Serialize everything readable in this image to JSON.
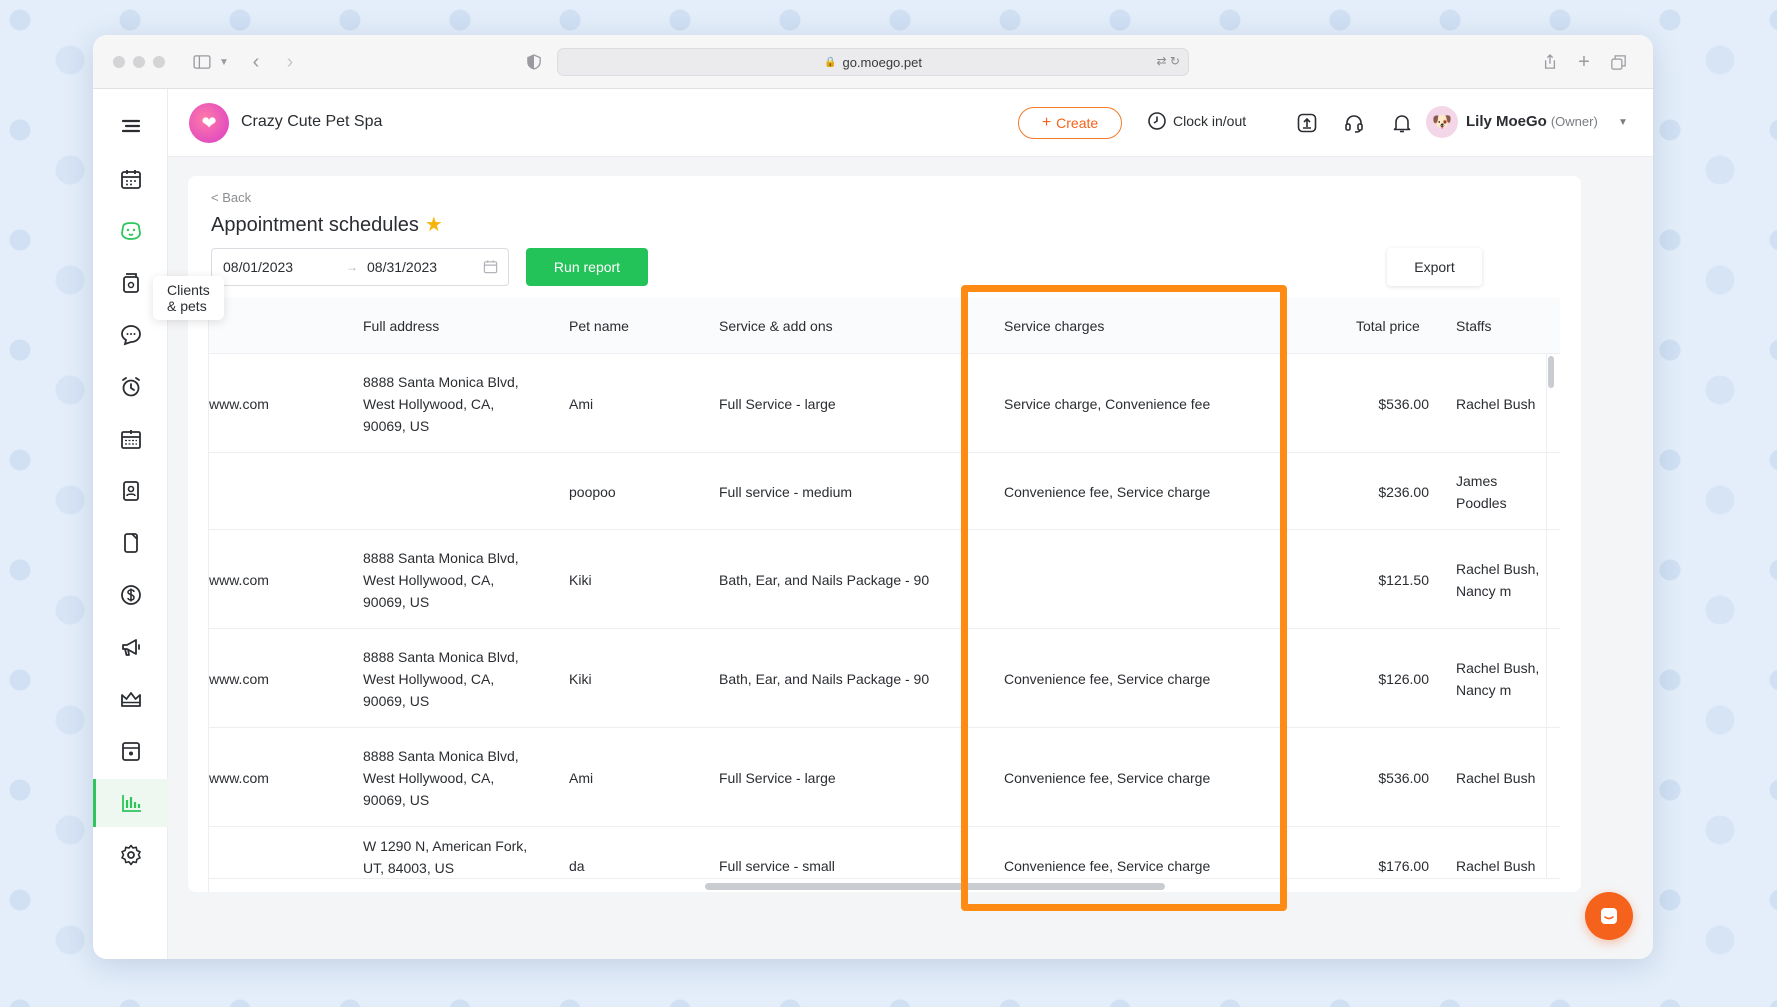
{
  "browser": {
    "url": "go.moego.pet"
  },
  "sidebar": {
    "tooltip": "Clients & pets",
    "items": [
      {
        "icon": "menu-icon"
      },
      {
        "icon": "calendar-icon"
      },
      {
        "icon": "clients-pets-icon"
      },
      {
        "icon": "pet-food-icon"
      },
      {
        "icon": "chat-bubble-icon"
      },
      {
        "icon": "alarm-clock-icon"
      },
      {
        "icon": "schedule-grid-icon"
      },
      {
        "icon": "id-badge-icon"
      },
      {
        "icon": "mobile-device-icon"
      },
      {
        "icon": "dollar-icon"
      },
      {
        "icon": "megaphone-icon"
      },
      {
        "icon": "crown-icon"
      },
      {
        "icon": "booking-icon"
      },
      {
        "icon": "reports-chart-icon"
      },
      {
        "icon": "settings-gear-icon"
      }
    ]
  },
  "header": {
    "business_name": "Crazy Cute Pet Spa",
    "create_label": "Create",
    "clock_label": "Clock in/out",
    "user_name": "Lily MoeGo",
    "user_role": "(Owner)"
  },
  "page": {
    "back_label": "< Back",
    "title": "Appointment schedules",
    "date_start": "08/01/2023",
    "date_end": "08/31/2023",
    "run_label": "Run report",
    "export_label": "Export"
  },
  "table": {
    "columns": [
      "Full address",
      "Pet name",
      "Service & add ons",
      "Service charges",
      "Total price",
      "Staffs"
    ],
    "rows": [
      {
        "email_tail": "www.com",
        "address": [
          "8888 Santa Monica Blvd,",
          "West Hollywood, CA,",
          "90069, US"
        ],
        "pet": "Ami",
        "service": "Full Service - large",
        "charges": "Service charge, Convenience fee",
        "total": "$536.00",
        "staffs": [
          "Rachel Bush"
        ]
      },
      {
        "email_tail": "",
        "address": [],
        "pet": "poopoo",
        "service": "Full service - medium",
        "charges": "Convenience fee, Service charge",
        "total": "$236.00",
        "staffs": [
          "James",
          "Poodles"
        ]
      },
      {
        "email_tail": "www.com",
        "address": [
          "8888 Santa Monica Blvd,",
          "West Hollywood, CA,",
          "90069, US"
        ],
        "pet": "Kiki",
        "service": "Bath, Ear, and Nails Package - 90",
        "charges": "",
        "total": "$121.50",
        "staffs": [
          "Rachel Bush,",
          "Nancy m"
        ]
      },
      {
        "email_tail": "www.com",
        "address": [
          "8888 Santa Monica Blvd,",
          "West Hollywood, CA,",
          "90069, US"
        ],
        "pet": "Kiki",
        "service": "Bath, Ear, and Nails Package - 90",
        "charges": "Convenience fee, Service charge",
        "total": "$126.00",
        "staffs": [
          "Rachel Bush,",
          "Nancy m"
        ]
      },
      {
        "email_tail": "www.com",
        "address": [
          "8888 Santa Monica Blvd,",
          "West Hollywood, CA,",
          "90069, US"
        ],
        "pet": "Ami",
        "service": "Full Service - large",
        "charges": "Convenience fee, Service charge",
        "total": "$536.00",
        "staffs": [
          "Rachel Bush"
        ]
      },
      {
        "email_tail": "",
        "address": [
          "W 1290 N, American Fork,",
          "UT, 84003, US"
        ],
        "pet": "da",
        "service": "Full service - small",
        "charges": "Convenience fee, Service charge",
        "total": "$176.00",
        "staffs": [
          "Rachel Bush"
        ]
      }
    ]
  },
  "colors": {
    "accent_orange": "#f4621c",
    "highlight_orange": "#ff8a14",
    "run_green": "#24c35a",
    "active_green": "#2ec55b"
  }
}
